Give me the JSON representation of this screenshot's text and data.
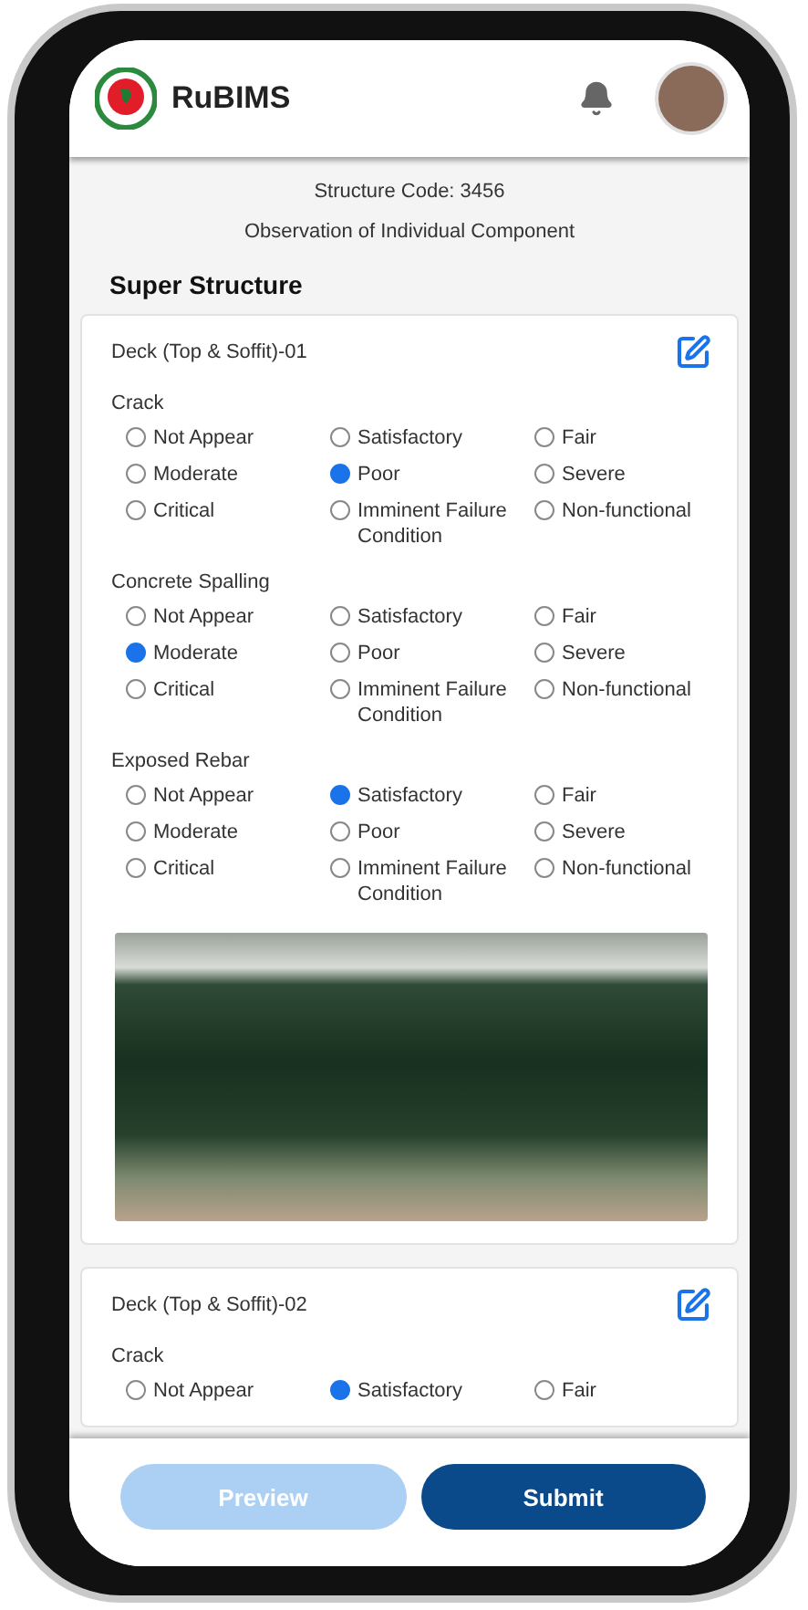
{
  "app": {
    "title": "RuBIMS"
  },
  "structure_code": "Structure Code: 3456",
  "subtitle": "Observation of Individual Component",
  "section_title": "Super Structure",
  "components": [
    {
      "title": "Deck (Top & Soffit)-01",
      "has_photo": true,
      "groups": [
        {
          "label": "Crack",
          "options": [
            {
              "label": "Not Appear",
              "selected": false
            },
            {
              "label": "Satisfactory",
              "selected": false
            },
            {
              "label": "Fair",
              "selected": false
            },
            {
              "label": "Moderate",
              "selected": false
            },
            {
              "label": "Poor",
              "selected": true
            },
            {
              "label": "Severe",
              "selected": false
            },
            {
              "label": "Critical",
              "selected": false
            },
            {
              "label": "Imminent Failure Condition",
              "selected": false
            },
            {
              "label": "Non-functional",
              "selected": false
            }
          ]
        },
        {
          "label": "Concrete Spalling",
          "options": [
            {
              "label": "Not Appear",
              "selected": false
            },
            {
              "label": "Satisfactory",
              "selected": false
            },
            {
              "label": "Fair",
              "selected": false
            },
            {
              "label": "Moderate",
              "selected": true
            },
            {
              "label": "Poor",
              "selected": false
            },
            {
              "label": "Severe",
              "selected": false
            },
            {
              "label": "Critical",
              "selected": false
            },
            {
              "label": "Imminent Failure Condition",
              "selected": false
            },
            {
              "label": "Non-functional",
              "selected": false
            }
          ]
        },
        {
          "label": "Exposed Rebar",
          "options": [
            {
              "label": "Not Appear",
              "selected": false
            },
            {
              "label": "Satisfactory",
              "selected": true
            },
            {
              "label": "Fair",
              "selected": false
            },
            {
              "label": "Moderate",
              "selected": false
            },
            {
              "label": "Poor",
              "selected": false
            },
            {
              "label": "Severe",
              "selected": false
            },
            {
              "label": "Critical",
              "selected": false
            },
            {
              "label": "Imminent Failure Condition",
              "selected": false
            },
            {
              "label": "Non-functional",
              "selected": false
            }
          ]
        }
      ]
    },
    {
      "title": "Deck (Top & Soffit)-02",
      "has_photo": false,
      "groups": [
        {
          "label": "Crack",
          "options": [
            {
              "label": "Not Appear",
              "selected": false
            },
            {
              "label": "Satisfactory",
              "selected": true
            },
            {
              "label": "Fair",
              "selected": false
            }
          ]
        }
      ]
    }
  ],
  "buttons": [
    {
      "label": "Preview",
      "disabled": true
    },
    {
      "label": "Submit",
      "disabled": false
    }
  ]
}
